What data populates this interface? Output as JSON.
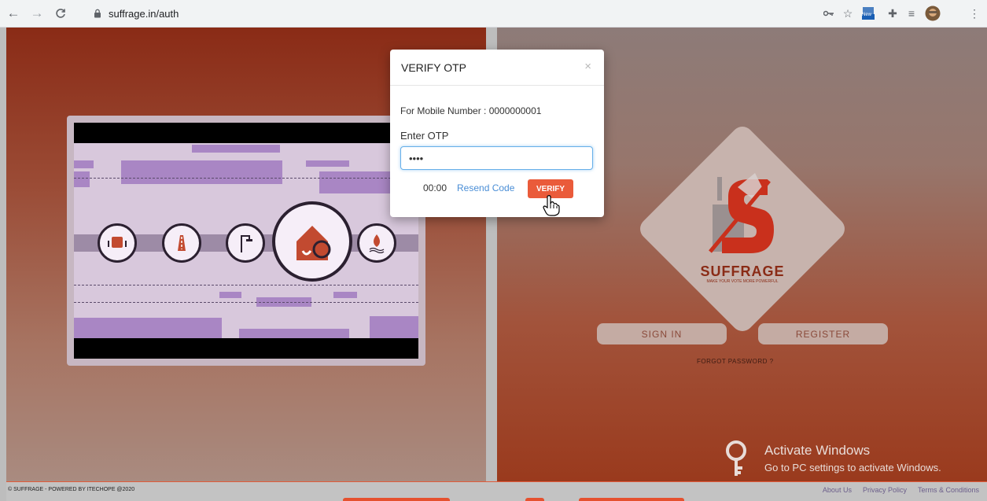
{
  "browser": {
    "url": "suffrage.in/auth",
    "ext_new_label": "New"
  },
  "auth": {
    "sign_in_label": "SIGN IN",
    "register_label": "REGISTER",
    "forgot_label": "FORGOT PASSWORD ?",
    "logo_text": "SUFFRAGE",
    "logo_tagline": "MAKE YOUR VOTE MORE POWERFUL"
  },
  "modal": {
    "title": "VERIFY OTP",
    "close_symbol": "×",
    "mobile_text": "For Mobile Number : 0000000001",
    "otp_label": "Enter OTP",
    "otp_value": "••••",
    "timer": "00:00",
    "resend_label": "Resend Code",
    "verify_label": "VERIFY"
  },
  "watermark": {
    "line1": "Activate Windows",
    "line2": "Go to PC settings to activate Windows."
  },
  "footer": {
    "copyright": "© SUFFRAGE - POWERED BY ITECHOPE @2020",
    "links": [
      "About Us",
      "Privacy Policy",
      "Terms & Conditions"
    ]
  },
  "colors": {
    "accent": "#ea5b3a",
    "link": "#4a8ed6"
  }
}
